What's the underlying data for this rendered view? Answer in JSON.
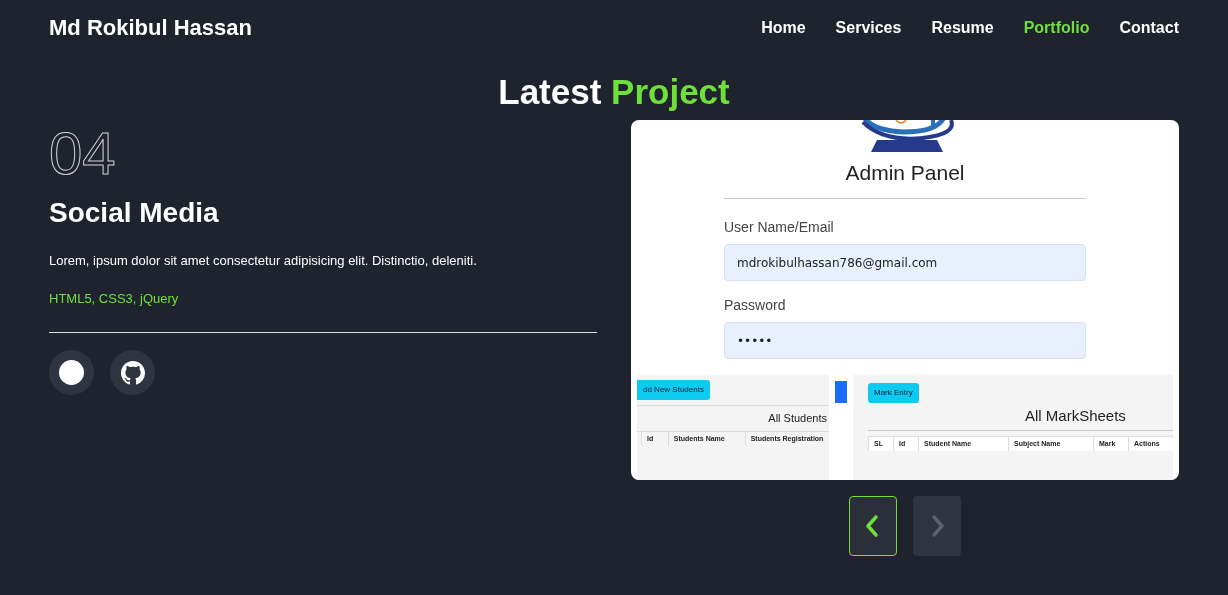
{
  "brand": "Md Rokibul Hassan",
  "nav": [
    {
      "label": "Home",
      "selected": false
    },
    {
      "label": "Services",
      "selected": false
    },
    {
      "label": "Resume",
      "selected": false
    },
    {
      "label": "Portfolio",
      "selected": true
    },
    {
      "label": "Contact",
      "selected": false
    }
  ],
  "heading": [
    {
      "text": "Latest",
      "accent": false
    },
    {
      "text": "Project",
      "accent": true
    }
  ],
  "project": {
    "number": "04",
    "title": "Social Media",
    "description": "Lorem, ipsum dolor sit amet consectetur adipisicing elit. Distinctio, deleniti.",
    "tech": "HTML5, CSS3, jQuery",
    "links": [
      {
        "kind": "circle"
      },
      {
        "kind": "github"
      }
    ]
  },
  "preview": {
    "title": "Admin Panel",
    "fields": [
      {
        "label": "User Name/Email",
        "value": "mdrokibulhassan786@gmail.com"
      },
      {
        "label": "Password",
        "value": "•••••"
      }
    ],
    "students": {
      "button": "dd New Students",
      "title": "All Students",
      "columns": [
        "Id",
        "Students Name",
        "Students Registration"
      ]
    },
    "marksheets": {
      "button": "Mark Entry",
      "title": "All MarkSheets",
      "columns": [
        "SL",
        "Id",
        "Student Name",
        "Subject Name",
        "Mark",
        "Actions"
      ]
    }
  },
  "carousel": [
    {
      "kind": "prev",
      "disabled": false
    },
    {
      "kind": "next",
      "disabled": true
    }
  ]
}
